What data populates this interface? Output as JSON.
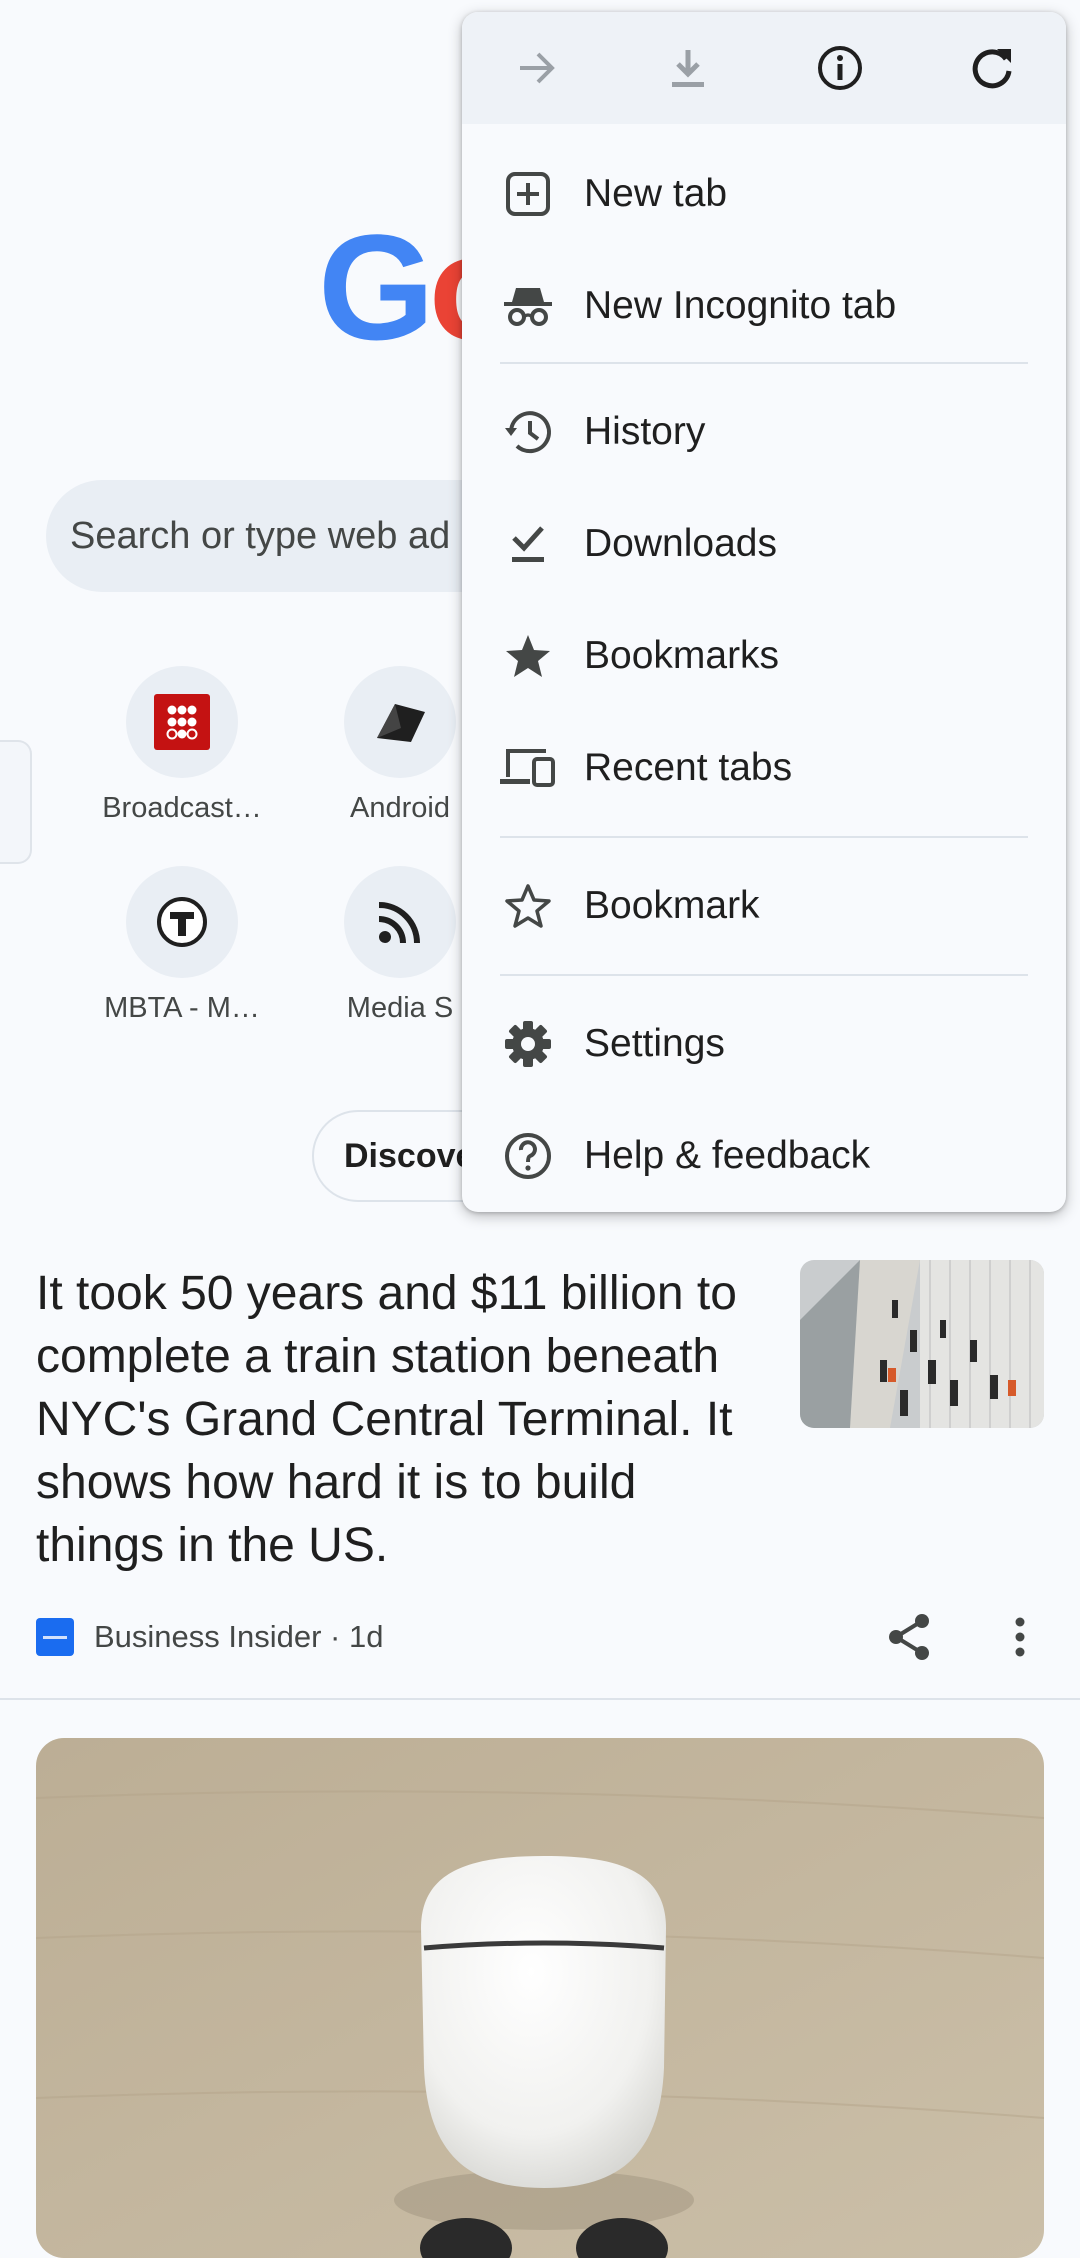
{
  "logo": {
    "part1": "G",
    "part2": "o"
  },
  "search": {
    "placeholder": "Search or type web ad"
  },
  "shortcuts": [
    {
      "label": "Broadcast…",
      "icon": "broadcastify-icon"
    },
    {
      "label": "Android",
      "icon": "android-police-icon"
    },
    {
      "label": "MBTA - M…",
      "icon": "mbta-icon"
    },
    {
      "label": "Media S",
      "icon": "rss-feed-icon"
    }
  ],
  "discover": {
    "label": "Discove"
  },
  "article": {
    "headline": "It took 50 years and $11 billion to complete a train station beneath NYC's Grand Central Terminal. It shows how hard it is to build things in the US.",
    "source": "Business Insider · 1d"
  },
  "menu": {
    "toolbar": [
      "forward-icon",
      "download-icon",
      "info-icon",
      "refresh-icon"
    ],
    "items": [
      {
        "label": "New tab",
        "icon": "new-tab-icon"
      },
      {
        "label": "New Incognito tab",
        "icon": "incognito-icon"
      },
      {
        "label": "History",
        "icon": "history-icon"
      },
      {
        "label": "Downloads",
        "icon": "downloads-icon"
      },
      {
        "label": "Bookmarks",
        "icon": "bookmarks-icon"
      },
      {
        "label": "Recent tabs",
        "icon": "recent-tabs-icon"
      },
      {
        "label": "Bookmark",
        "icon": "bookmark-star-icon"
      },
      {
        "label": "Settings",
        "icon": "settings-icon"
      },
      {
        "label": "Help & feedback",
        "icon": "help-icon"
      }
    ]
  },
  "colors": {
    "accent": "#4285f4",
    "red": "#ea4335",
    "surface": "#f8fafd",
    "icon": "#444746"
  }
}
